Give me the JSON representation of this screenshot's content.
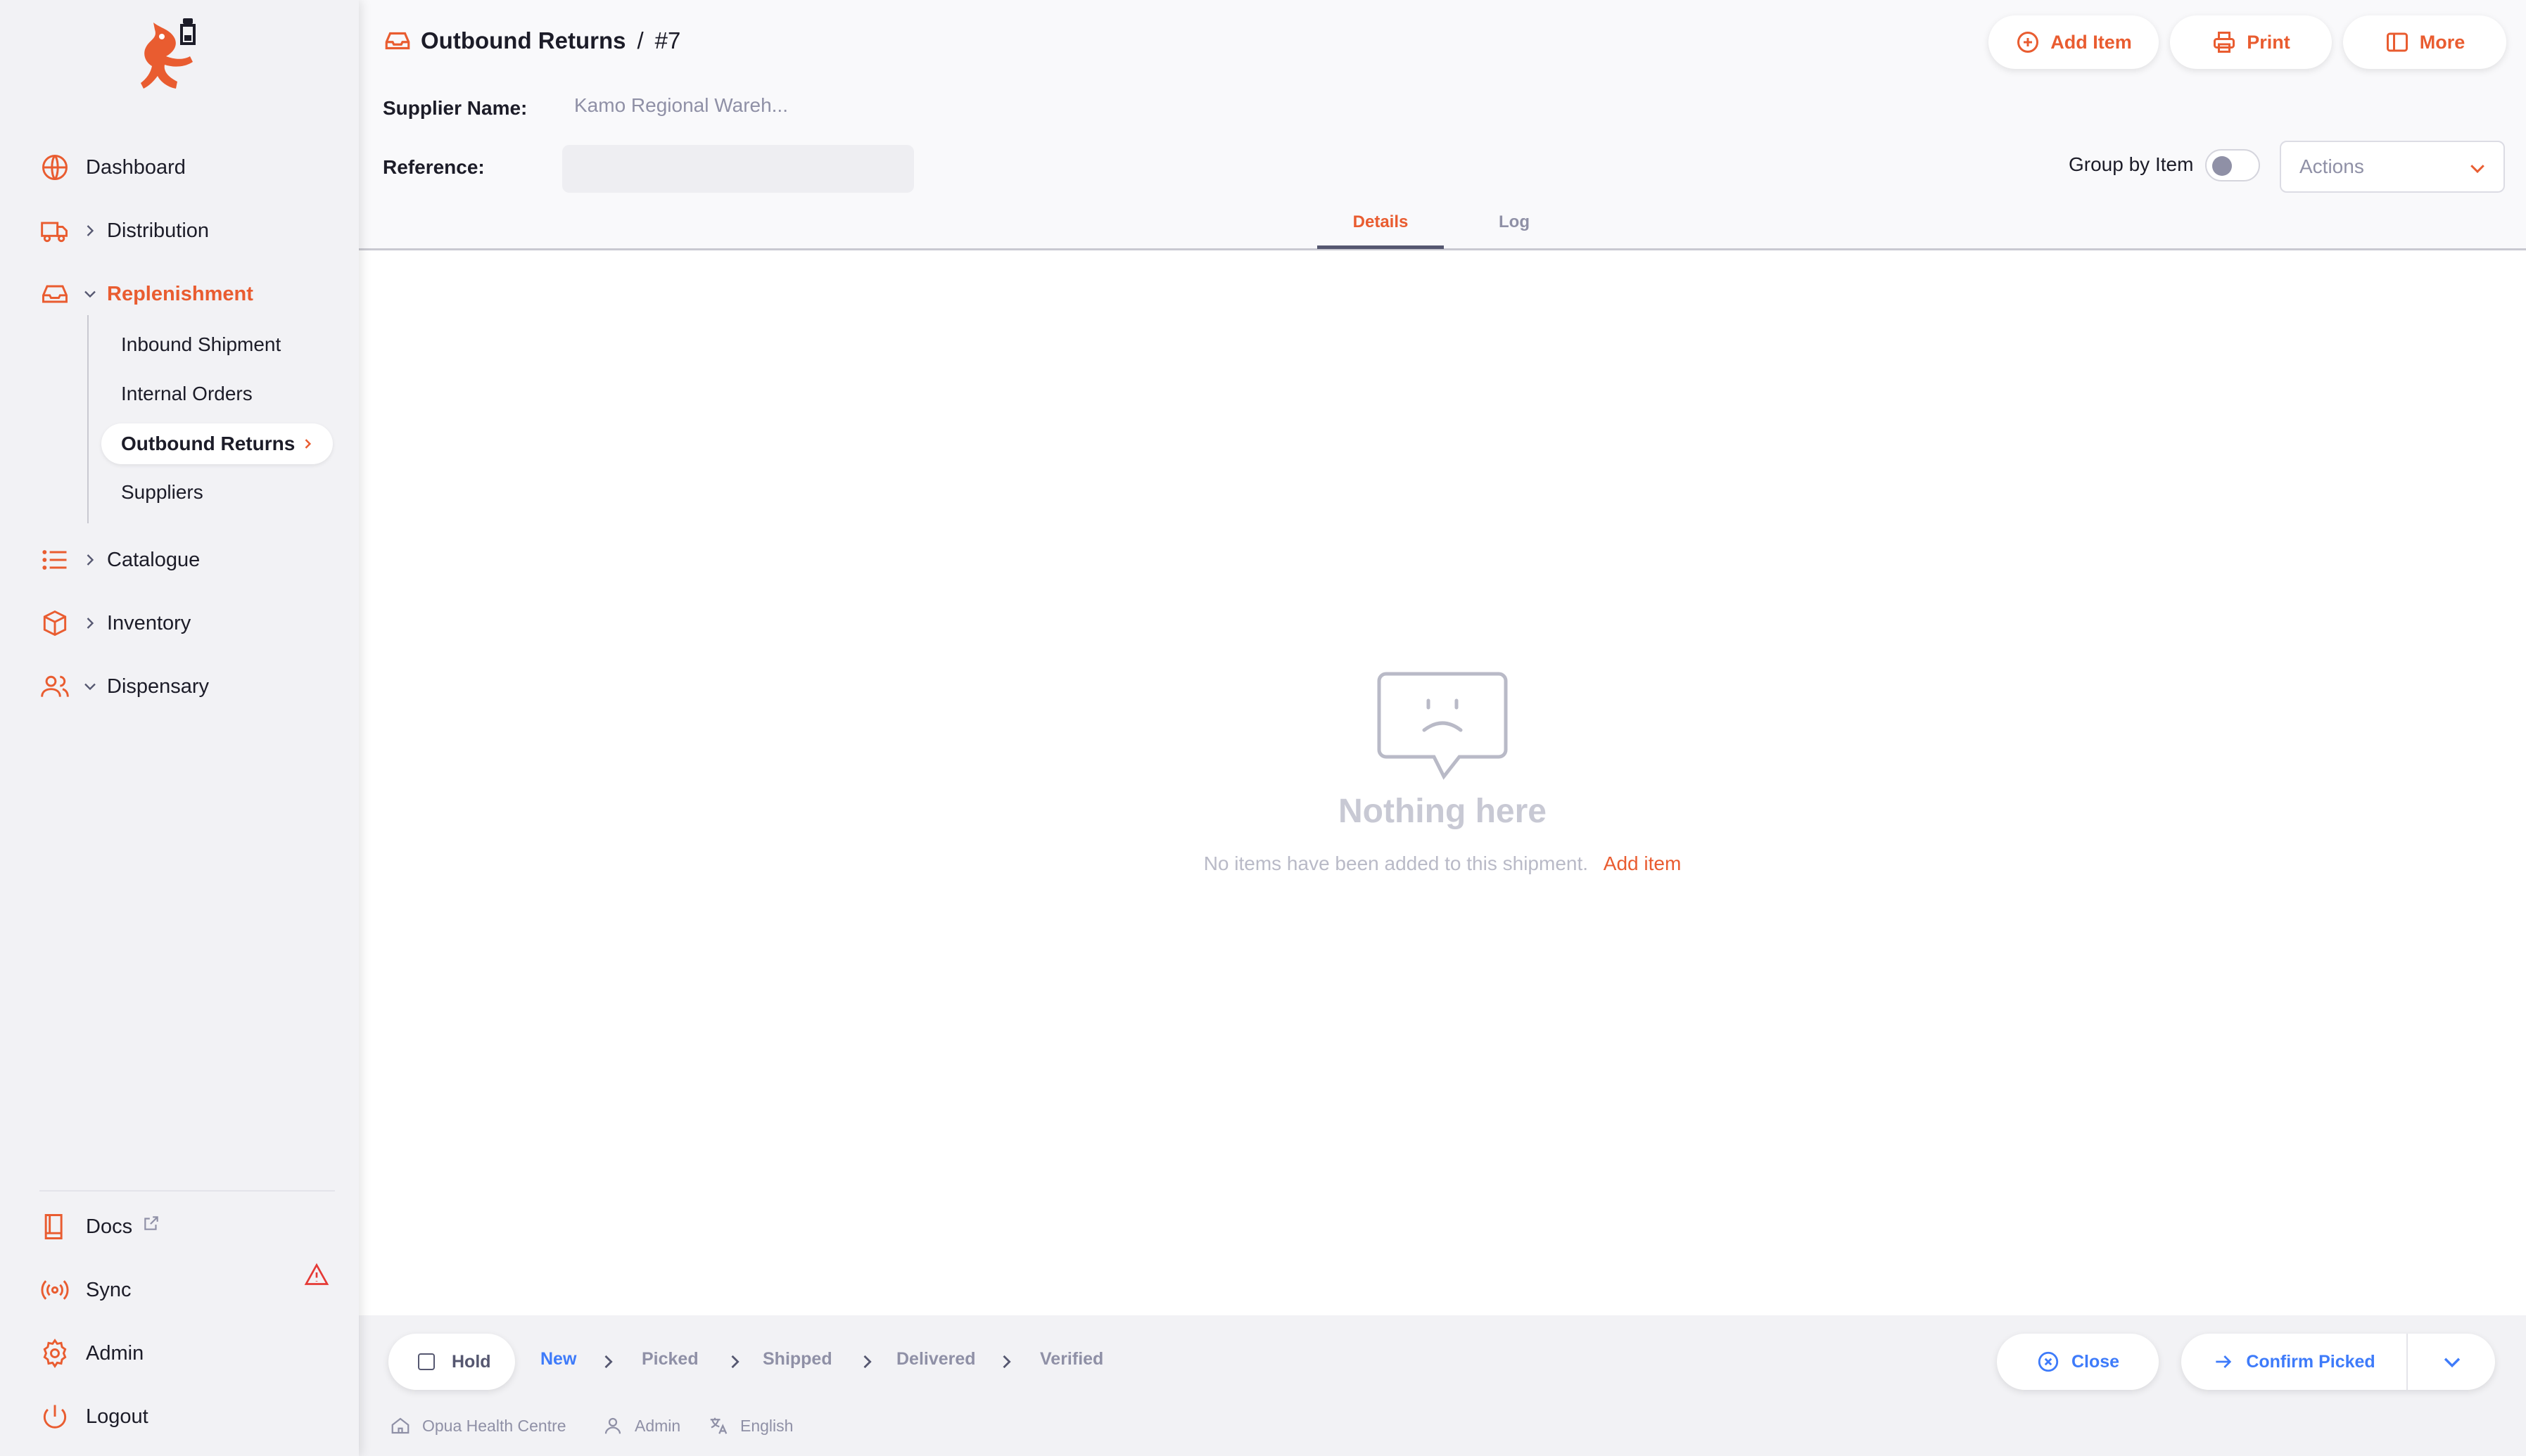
{
  "colors": {
    "accent": "#e95c30",
    "blue": "#3e7bfa",
    "muted": "#8f90a6",
    "sidebar_bg": "#f2f2f5"
  },
  "sidebar": {
    "nav": [
      {
        "label": "Dashboard",
        "icon": "globe-icon"
      },
      {
        "label": "Distribution",
        "icon": "truck-icon"
      },
      {
        "label": "Replenishment",
        "icon": "inbox-icon",
        "expanded": true
      },
      {
        "label": "Catalogue",
        "icon": "list-icon"
      },
      {
        "label": "Inventory",
        "icon": "box-icon"
      },
      {
        "label": "Dispensary",
        "icon": "users-icon"
      }
    ],
    "sub": [
      {
        "label": "Inbound Shipment"
      },
      {
        "label": "Internal Orders"
      },
      {
        "label": "Outbound Returns",
        "selected": true
      },
      {
        "label": "Suppliers"
      }
    ],
    "footer": [
      {
        "label": "Docs",
        "icon": "book-icon"
      },
      {
        "label": "Sync",
        "icon": "sync-icon"
      },
      {
        "label": "Admin",
        "icon": "gear-icon"
      },
      {
        "label": "Logout",
        "icon": "power-icon"
      }
    ]
  },
  "header": {
    "breadcrumb": {
      "section": "Outbound Returns",
      "separator": "/",
      "number": "#7"
    },
    "buttons": {
      "add_item": "Add Item",
      "print": "Print",
      "more": "More"
    },
    "supplier_label": "Supplier Name:",
    "supplier_value": "Kamo Regional Wareh...",
    "reference_label": "Reference:",
    "reference_value": "",
    "group_by_label": "Group by Item",
    "group_by_on": false,
    "actions_placeholder": "Actions",
    "tabs": [
      {
        "label": "Details",
        "active": true
      },
      {
        "label": "Log",
        "active": false
      }
    ]
  },
  "empty_state": {
    "title": "Nothing here",
    "message": "No items have been added to this shipment.",
    "link": "Add item"
  },
  "footer": {
    "hold_label": "Hold",
    "statuses": [
      "New",
      "Picked",
      "Shipped",
      "Delivered",
      "Verified"
    ],
    "current_status": "New",
    "close_label": "Close",
    "confirm_label": "Confirm Picked",
    "store": "Opua Health Centre",
    "user": "Admin",
    "language": "English"
  }
}
